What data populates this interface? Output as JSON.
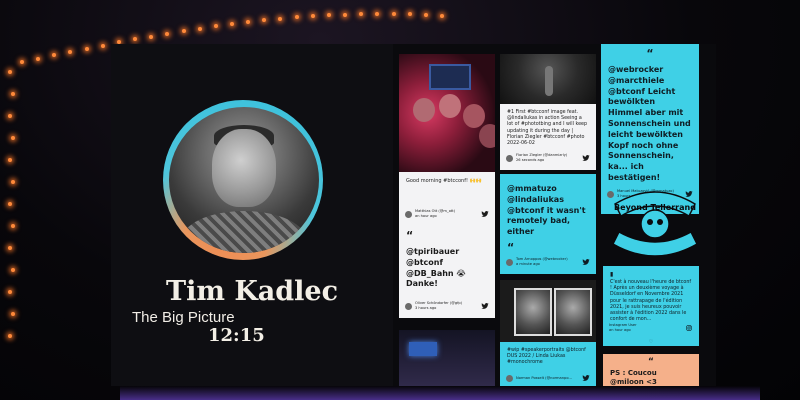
{
  "speaker": {
    "name": "Tim Kadlec",
    "talk_title": "The Big Picture",
    "time": "12:15"
  },
  "wall": {
    "tweets": [
      {
        "id": "good-morning",
        "text": "Good morning #btcconf! 🙌🙌",
        "author": "Matthias Ott (@m_ott)",
        "time": "an hour ago"
      },
      {
        "id": "first-image",
        "text": "#1 First #btcconf image feat. @lindaliukas in action Seeing a lot of #phototbing and I will keep updating it during the day | Florian Ziegler #btcconf #photo 2022-06-02",
        "author": "Florian Ziegler (@danmizrly)",
        "time": "26 seconds ago"
      },
      {
        "id": "webrocker",
        "text": "@webrocker @marcthiele @btconf Leicht bewölkten Himmel aber mit Sonnenschein und leicht bewölkten Kopf noch ohne Sonnenschein, ka... ich bestätigen!",
        "author": "Manuel Matuzović (@mmatuzo)",
        "time": "3 hours ago"
      },
      {
        "id": "mmatuzo",
        "text": "@mmatuzo @lindaliukas @btconf it wasn't remotely bad, either",
        "author": "Tom Arnoppos (@webrocker)",
        "time": "a minute ago"
      },
      {
        "id": "tpiribauer",
        "text": "@tpiribauer @btconf @DB_Bahn 😭 Danke!",
        "author": "Oliver Schöndorfer (@gfp)",
        "time": "3 hours ago"
      },
      {
        "id": "french",
        "text": "C'est à nouveau l'heure de btconf ! Après un deuxième voyage à Düsseldorf en Novembre 2021 pour le rattrapage de l'édition 2021, je suis heureux pouvoir assister à l'édition 2022 dans le confort de mon...",
        "author": "Instagram User",
        "time": "an hour ago"
      },
      {
        "id": "speakerportraits",
        "text": "#wip #speakerportraits @btconf DUS 2022 / Linda Liukas #monochrome",
        "author": "Norman Posselt (@normanpo...",
        "time": ""
      },
      {
        "id": "coucou",
        "text": "PS : Coucou @miloon <3",
        "author": "",
        "time": ""
      }
    ],
    "badge_text": "Beyond Tellerrand"
  },
  "colors": {
    "cyan": "#3fd0e6",
    "peach": "#f5b08a",
    "ring_orange": "#f08a52",
    "ring_cyan": "#35bfdc"
  },
  "icons": {
    "tweet": "twitter-bird-icon",
    "instagram": "instagram-icon",
    "heart": "heart-icon",
    "quote": "quote-icon"
  }
}
